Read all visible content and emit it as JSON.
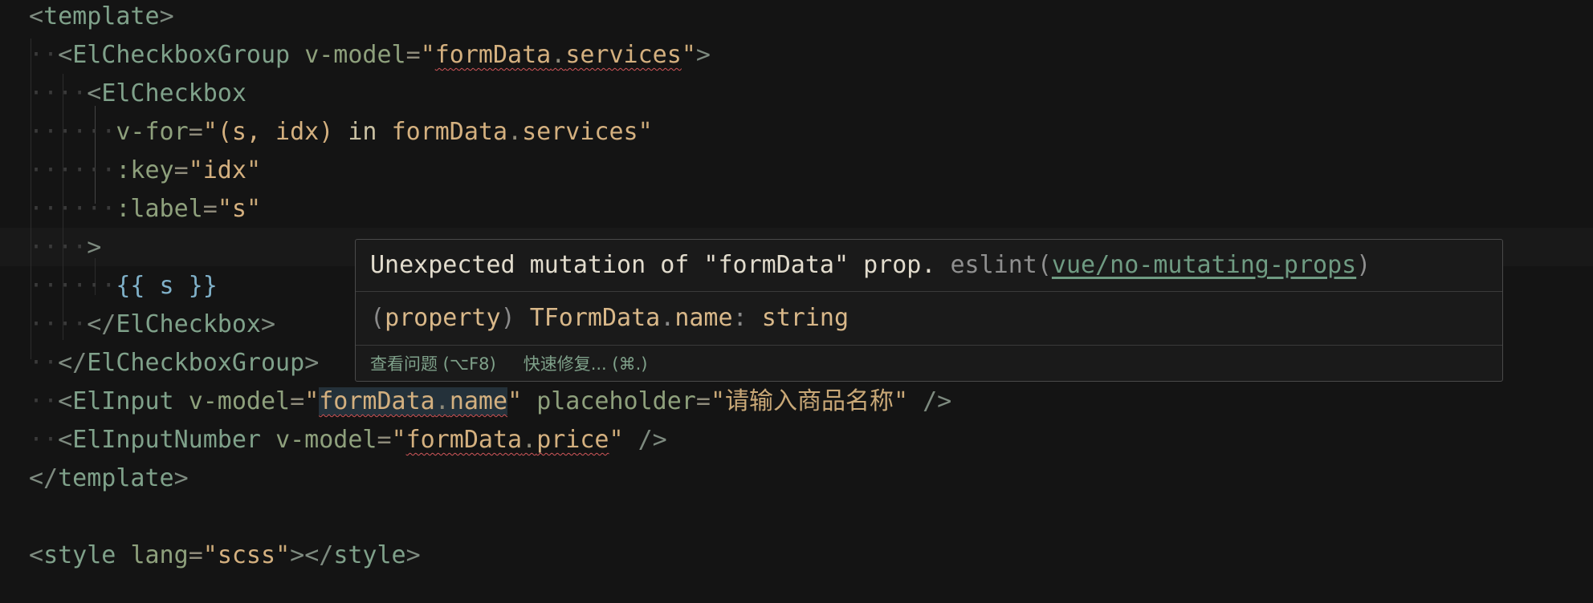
{
  "code": {
    "l1": {
      "open": "<",
      "tag": "template",
      "close": ">"
    },
    "l2": {
      "ws": "··",
      "open": "<",
      "tag": "ElCheckboxGroup",
      "attr": "v-model",
      "eq": "=",
      "q1": "\"",
      "v1": "formData",
      "dot": ".",
      "v2": "services",
      "q2": "\"",
      "close": ">"
    },
    "l3": {
      "ws": "····",
      "open": "<",
      "tag": "ElCheckbox"
    },
    "l4": {
      "ws": "······",
      "attr": "v-for",
      "eq": "=",
      "q1": "\"",
      "expr": "(s, idx)",
      "kw": " in ",
      "v1": "formData",
      "dot": ".",
      "v2": "services",
      "q2": "\""
    },
    "l5": {
      "ws": "······",
      "attr": ":key",
      "eq": "=",
      "q1": "\"",
      "v": "idx",
      "q2": "\""
    },
    "l6": {
      "ws": "······",
      "attr": ":label",
      "eq": "=",
      "q1": "\"",
      "v": "s",
      "q2": "\""
    },
    "l7": {
      "ws": "····",
      "close": ">"
    },
    "l8": {
      "ws": "······",
      "mus": "{{ s }}"
    },
    "l9": {
      "ws": "····",
      "open": "</",
      "tag": "ElCheckbox",
      "close": ">"
    },
    "l10": {
      "ws": "··",
      "open": "</",
      "tag": "ElCheckboxGroup",
      "close": ">"
    },
    "l11": {
      "ws": "··",
      "open": "<",
      "tag": "ElInput",
      "attr": "v-model",
      "eq": "=",
      "q1": "\"",
      "v1": "formData",
      "dot": ".",
      "v2": "name",
      "q2": "\"",
      "attr2": "placeholder",
      "eq2": "=",
      "q3": "\"",
      "ph": "请输入商品名称",
      "q4": "\"",
      "selfclose": " />"
    },
    "l12": {
      "ws": "··",
      "open": "<",
      "tag": "ElInputNumber",
      "attr": "v-model",
      "eq": "=",
      "q1": "\"",
      "v1": "formData",
      "dot": ".",
      "v2": "price",
      "q2": "\"",
      "selfclose": " />"
    },
    "l13": {
      "open": "</",
      "tag": "template",
      "close": ">"
    },
    "l15": {
      "open": "<",
      "tag": "style",
      "attr": "lang",
      "eq": "=",
      "q1": "\"",
      "v": "scss",
      "q2": "\"",
      "close": ">",
      "open2": "</",
      "tag2": "style",
      "close2": ">"
    }
  },
  "hover": {
    "message": "Unexpected mutation of \"formData\" prop.",
    "source": "eslint(",
    "rule": "vue/no-mutating-props",
    "source_close": ")",
    "sig_open": "(",
    "sig_kind": "property",
    "sig_close": ")",
    "sig_owner": "TFormData",
    "sig_dot": ".",
    "sig_name": "name",
    "sig_colon": ":",
    "sig_type": "string",
    "action_view": "查看问题 (⌥F8)",
    "action_fix": "快速修复... (⌘.)"
  }
}
